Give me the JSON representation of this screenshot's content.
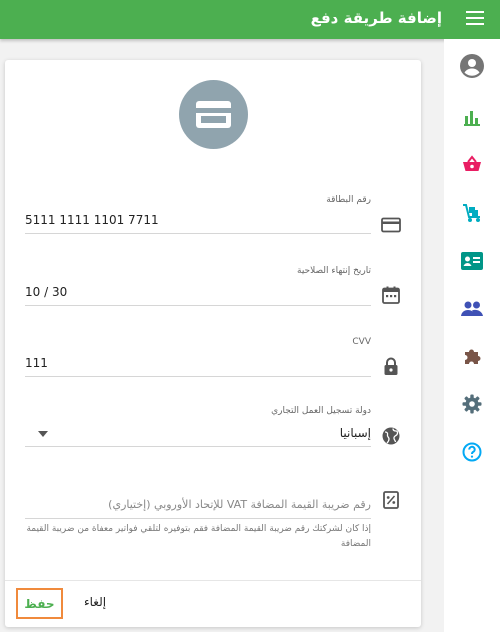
{
  "appbar": {
    "title": "إضافة طريقة دفع"
  },
  "sidebar": {
    "items": [
      {
        "icon": "account-circle-icon",
        "color": "#757575"
      },
      {
        "icon": "bar-chart-icon",
        "color": "#4caf50"
      },
      {
        "icon": "basket-icon",
        "color": "#e91e63"
      },
      {
        "icon": "cart-icon",
        "color": "#00acc1"
      },
      {
        "icon": "id-card-icon",
        "color": "#009688"
      },
      {
        "icon": "people-icon",
        "color": "#3f51b5"
      },
      {
        "icon": "puzzle-icon",
        "color": "#795548"
      },
      {
        "icon": "gear-icon",
        "color": "#546e7a"
      },
      {
        "icon": "help-icon",
        "color": "#03a9f4"
      }
    ]
  },
  "form": {
    "card_number": {
      "label": "رقم البطاقة",
      "value": "5111 1111 1101 7711"
    },
    "expiry": {
      "label": "تاريخ إنتهاء الصلاحية",
      "value": "10 / 30"
    },
    "cvv": {
      "label": "CVV",
      "value": "111"
    },
    "country": {
      "label": "دولة تسجيل العمل التجاري",
      "value": "إسبانيا"
    },
    "vat": {
      "placeholder": "رقم ضريبة القيمة المضافة VAT للإتحاد الأوروبي (إختياري)",
      "hint": "إذا كان لشركتك رقم ضريبة القيمة المضافة فقم بتوفيره لتلقي فواتير معفاة من ضريبة القيمة المضافة"
    }
  },
  "actions": {
    "save": "حفظ",
    "cancel": "إلغاء"
  },
  "colors": {
    "primary": "#4caf50",
    "focus_outline": "#f08a3c",
    "avatar": "#90a4ae"
  }
}
